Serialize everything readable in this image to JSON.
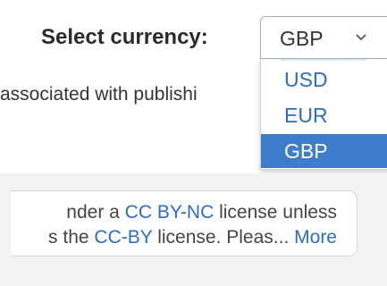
{
  "currency": {
    "label": "Select currency:",
    "selected": "GBP",
    "options": [
      "USD",
      "EUR",
      "GBP"
    ]
  },
  "content": {
    "partial_text": "associated with publishi"
  },
  "notice": {
    "line1_start": "nder a ",
    "line1_link": "CC BY-NC",
    "line1_end": " license unless",
    "line2_start": "s the ",
    "line2_link": "CC-BY",
    "line2_end": " license. Pleas...",
    "more_link": "More"
  },
  "colors": {
    "link": "#2d6dbf",
    "highlight": "#3d7dcb"
  }
}
